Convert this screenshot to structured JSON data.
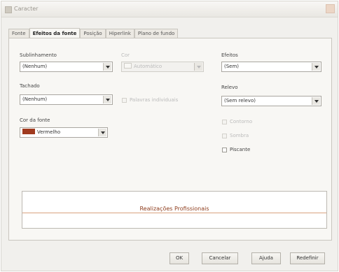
{
  "window": {
    "title": "Caracter"
  },
  "tabs": [
    {
      "label": "Fonte"
    },
    {
      "label": "Efeitos da fonte"
    },
    {
      "label": "Posição"
    },
    {
      "label": "Hiperlink"
    },
    {
      "label": "Plano de fundo"
    }
  ],
  "font_effects": {
    "underline": {
      "label": "Sublinhamento",
      "value": "(Nenhum)"
    },
    "underline_color": {
      "label": "Cor",
      "value": "Automático"
    },
    "strikethrough": {
      "label": "Tachado",
      "value": "(Nenhum)"
    },
    "individual_words": {
      "label": "Palavras individuais"
    },
    "font_color": {
      "label": "Cor da fonte",
      "value": "Vermelho",
      "swatch_color": "#a03a1e"
    },
    "relief": {
      "label": "Efeitos",
      "value": "(Sem)"
    },
    "emphasis": {
      "label": "Relevo",
      "value": "(Sem relevo)"
    },
    "outline": {
      "label": "Contorno"
    },
    "shadow": {
      "label": "Sombra"
    },
    "blinking": {
      "label": "Piscante"
    }
  },
  "preview": {
    "text": "Realizações Profissionais",
    "text_color": "#8e3d1d"
  },
  "buttons": {
    "ok": "OK",
    "cancel": "Cancelar",
    "help": "Ajuda",
    "reset": "Redefinir"
  }
}
